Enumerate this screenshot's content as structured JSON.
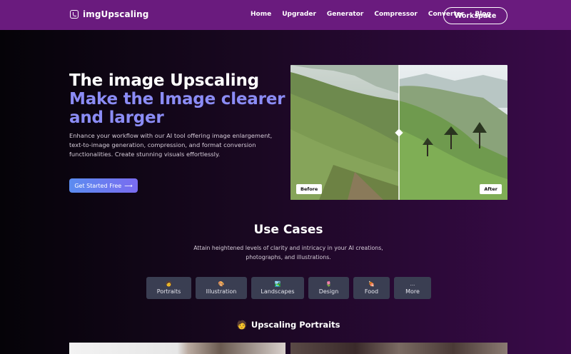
{
  "header": {
    "logo_text": "imgUpscaling",
    "nav": [
      "Home",
      "Upgrader",
      "Generator",
      "Compressor",
      "Converter",
      "Blog"
    ],
    "workspace_label": "Workspace"
  },
  "hero": {
    "title_plain": "The image Upscaling ",
    "title_accent": "Make the Image clearer and larger",
    "description": "Enhance your workflow with our AI tool offering image enlargement, text-to-image generation, compression, and format conversion functionalities. Create stunning visuals effortlessly.",
    "cta_label": "Get Started Free",
    "cta_arrow": "⟶"
  },
  "compare": {
    "before_label": "Before",
    "after_label": "After"
  },
  "use_cases": {
    "title": "Use Cases",
    "desc_line1": "Attain heightened levels of clarity and intricacy in your AI creations,",
    "desc_line2": "photographs, and illustrations.",
    "categories": [
      {
        "icon": "🧑",
        "label": "Portraits"
      },
      {
        "icon": "🎨",
        "label": "Illustration"
      },
      {
        "icon": "🏞️",
        "label": "Landscapes"
      },
      {
        "icon": "🌷",
        "label": "Design"
      },
      {
        "icon": "🍖",
        "label": "Food"
      },
      {
        "icon": "...",
        "label": "More"
      }
    ]
  },
  "section": {
    "icon": "🧑",
    "title": "Upscaling Portraits"
  },
  "colors": {
    "topbar": "#6a1b7e",
    "accent": "#8b8cf5",
    "cta_start": "#5b8cf0",
    "cta_end": "#7a6cf0",
    "chip": "#3a3e52"
  }
}
